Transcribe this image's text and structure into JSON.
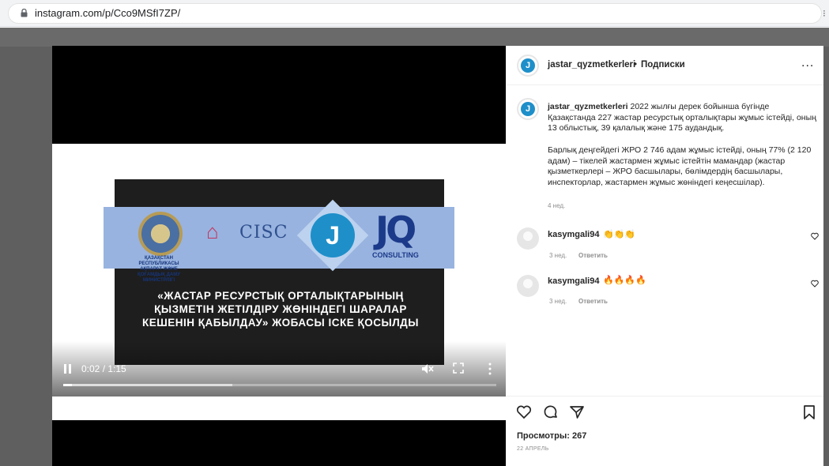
{
  "browser": {
    "url": "instagram.com/p/Cco9MSfI7ZP/"
  },
  "video": {
    "logos": {
      "ministry_caption": "ҚАЗАҚСТАН РЕСПУБЛИКАСЫ АҚПАРАТ ЖӘНЕ ҚОҒАМДЫҚ ДАМУ МИНИСТРЛІГІ",
      "cisc": "CISC",
      "j_letter": "J",
      "jq": "JQ",
      "jq_sub": "CONSULTING"
    },
    "slide_text": "«ЖАСТАР РЕСУРСТЫҚ ОРТАЛЫҚТАРЫНЫҢ ҚЫЗМЕТІН ЖЕТІЛДІРУ ЖӨНІНДЕГІ ШАРАЛАР КЕШЕНІН ҚАБЫЛДАУ» ЖОБАСЫ ІСКЕ ҚОСЫЛДЫ",
    "time": "0:02 / 1:15",
    "progress": 0.02,
    "buffered": 0.39
  },
  "post": {
    "username": "jastar_qyzmetkerleri",
    "separator": "•",
    "follow_label": "Подписки",
    "more": "...",
    "caption_p1": "2022 жылғы дерек бойынша бүгінде Қазақстанда 227 жастар ресурстық орталықтары жұмыс істейді, оның 13 облыстық, 39 қалалық және 175 аудандық.",
    "caption_p2": "Барлық деңгейдегі ЖРО 2 746 адам жұмыс істейді, оның 77% (2 120 адам) – тікелей жастармен жұмыс істейтін мамандар (жастар қызметкерлері – ЖРО басшылары, бөлімдердің басшылары, инспекторлар, жастармен жұмыс жөніндегі кеңесшілар).",
    "caption_time": "4 нед.",
    "comments": [
      {
        "user": "kasymgali94",
        "text": "👏👏👏",
        "time": "3 нед.",
        "reply": "Ответить"
      },
      {
        "user": "kasymgali94",
        "text": "🔥🔥🔥🔥",
        "time": "3 нед.",
        "reply": "Ответить"
      }
    ],
    "views": "Просмотры: 267",
    "date": "22 АПРЕЛЬ"
  }
}
